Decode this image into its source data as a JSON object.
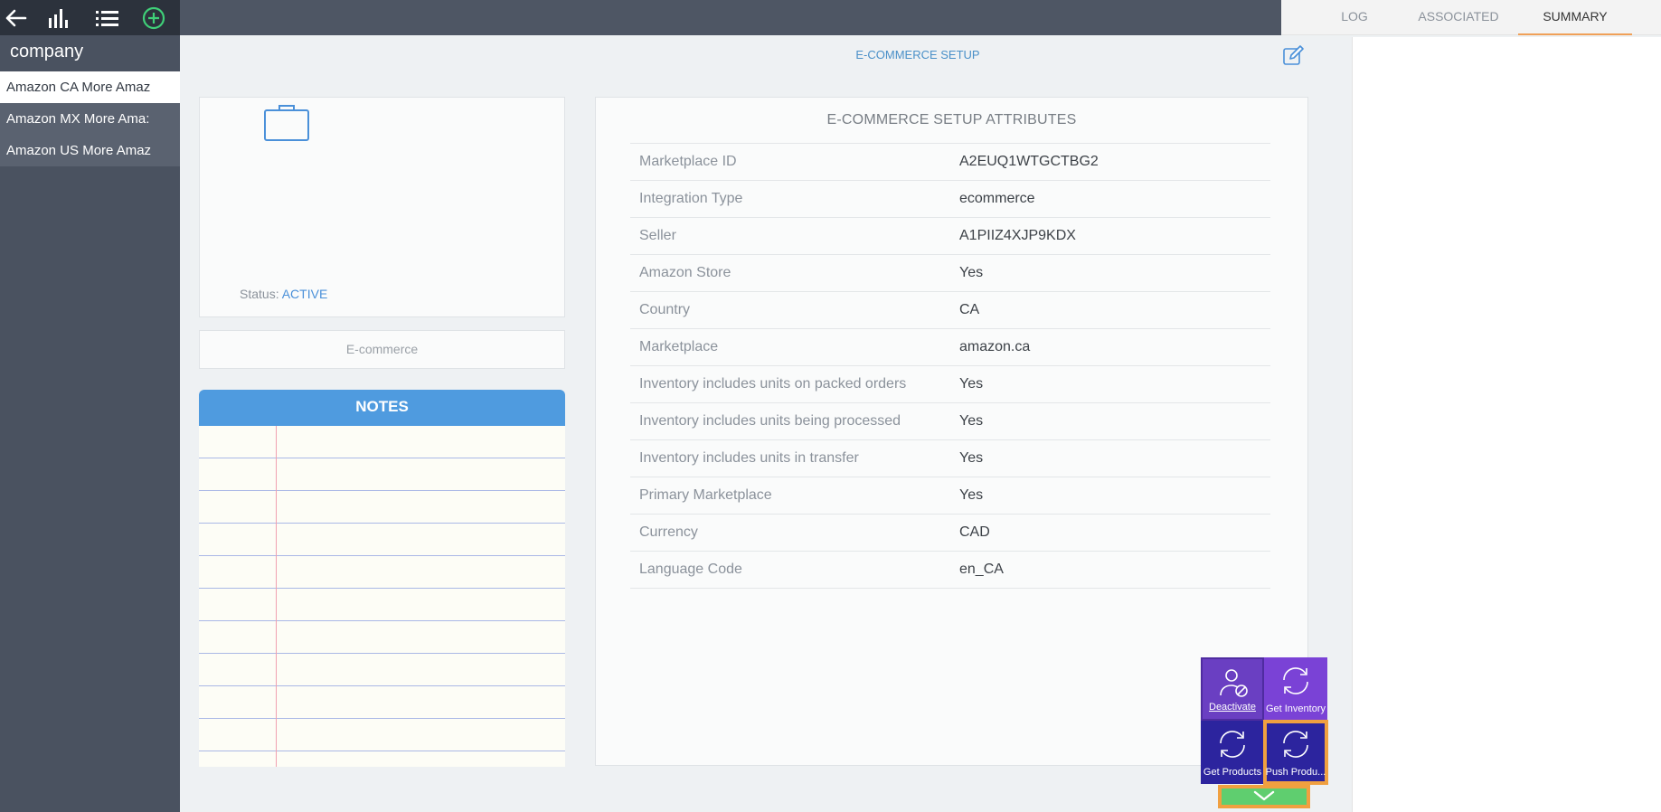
{
  "sidebar": {
    "toolbar": [
      "back-arrow-icon",
      "bar-chart-icon",
      "list-icon",
      "add-circle-icon"
    ],
    "company_label": "company",
    "items": [
      {
        "label": "Amazon CA More Amaz",
        "active": true
      },
      {
        "label": "Amazon MX More Ama:",
        "active": false
      },
      {
        "label": "Amazon US More Amaz",
        "active": false
      }
    ]
  },
  "tabs": {
    "log": "LOG",
    "associated": "ASSOCIATED",
    "summary": "SUMMARY",
    "active": "summary"
  },
  "main": {
    "title": "E-COMMERCE SETUP",
    "status_label": "Status:",
    "status_value": "ACTIVE",
    "type_label": "E-commerce",
    "notes_title": "NOTES"
  },
  "attributes": {
    "title": "E-COMMERCE SETUP ATTRIBUTES",
    "rows": [
      {
        "key": "Marketplace ID",
        "value": "A2EUQ1WTGCTBG2"
      },
      {
        "key": "Integration Type",
        "value": "ecommerce"
      },
      {
        "key": "Seller",
        "value": "A1PIIZ4XJP9KDX"
      },
      {
        "key": "Amazon Store",
        "value": "Yes"
      },
      {
        "key": "Country",
        "value": "CA"
      },
      {
        "key": "Marketplace",
        "value": "amazon.ca"
      },
      {
        "key": "Inventory includes units on packed orders",
        "value": "Yes"
      },
      {
        "key": "Inventory includes units being processed",
        "value": "Yes"
      },
      {
        "key": "Inventory includes units in transfer",
        "value": "Yes"
      },
      {
        "key": "Primary Marketplace",
        "value": "Yes"
      },
      {
        "key": "Currency",
        "value": "CAD"
      },
      {
        "key": "Language Code",
        "value": "en_CA"
      }
    ]
  },
  "actions": {
    "deactivate": "Deactivate",
    "get_inventory": "Get Inventory",
    "get_products": "Get Products",
    "push_products": "Push Produ..."
  },
  "colors": {
    "accent_blue": "#4a90d9",
    "notes_header": "#4f9bdf",
    "highlight_orange": "#f0a040",
    "expand_green": "#5fce6f"
  }
}
